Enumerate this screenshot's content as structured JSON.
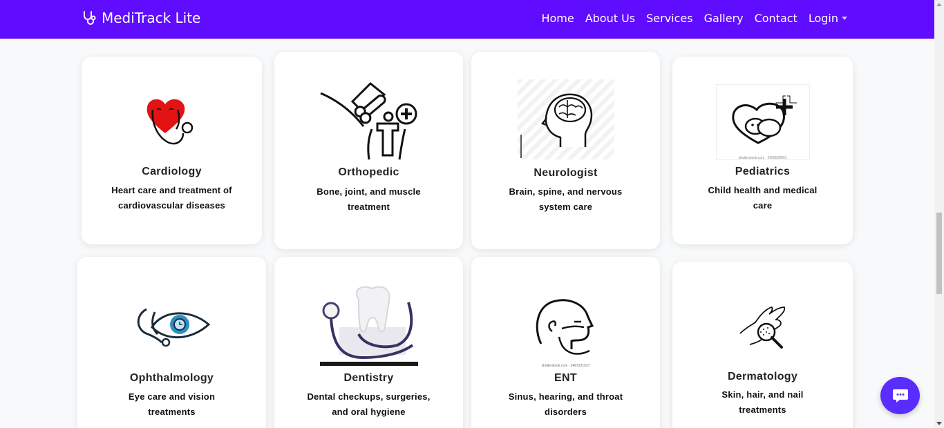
{
  "navbar": {
    "brand": "MediTrack Lite",
    "links": [
      "Home",
      "About Us",
      "Services",
      "Gallery",
      "Contact",
      "Login"
    ]
  },
  "services": [
    {
      "title": "Cardiology",
      "desc": "Heart care and treatment of cardiovascular diseases",
      "icon": "heart-stethoscope-icon"
    },
    {
      "title": "Orthopedic",
      "desc": "Bone, joint, and muscle treatment",
      "icon": "bone-joint-icon"
    },
    {
      "title": "Neurologist",
      "desc": "Brain, spine, and nervous system care",
      "icon": "brain-head-icon"
    },
    {
      "title": "Pediatrics",
      "desc": "Child health and medical care",
      "icon": "baby-heart-icon"
    },
    {
      "title": "Ophthalmology",
      "desc": "Eye care and vision treatments",
      "icon": "eye-stethoscope-icon"
    },
    {
      "title": "Dentistry",
      "desc": "Dental checkups, surgeries, and oral hygiene",
      "icon": "tooth-stethoscope-icon"
    },
    {
      "title": "ENT",
      "desc": "Sinus, hearing, and throat disorders",
      "icon": "head-throat-icon"
    },
    {
      "title": "Dermatology",
      "desc": "Skin, hair, and nail treatments",
      "icon": "hand-magnifier-icon"
    }
  ],
  "watermarks": {
    "pediatrics": "shutterstock.com · 2459528661",
    "ent": "shutterstock.com · 2467221527"
  },
  "colors": {
    "navbar": "#5f0cff",
    "chat_button": "#5a2dff",
    "heart": "#e11313"
  }
}
